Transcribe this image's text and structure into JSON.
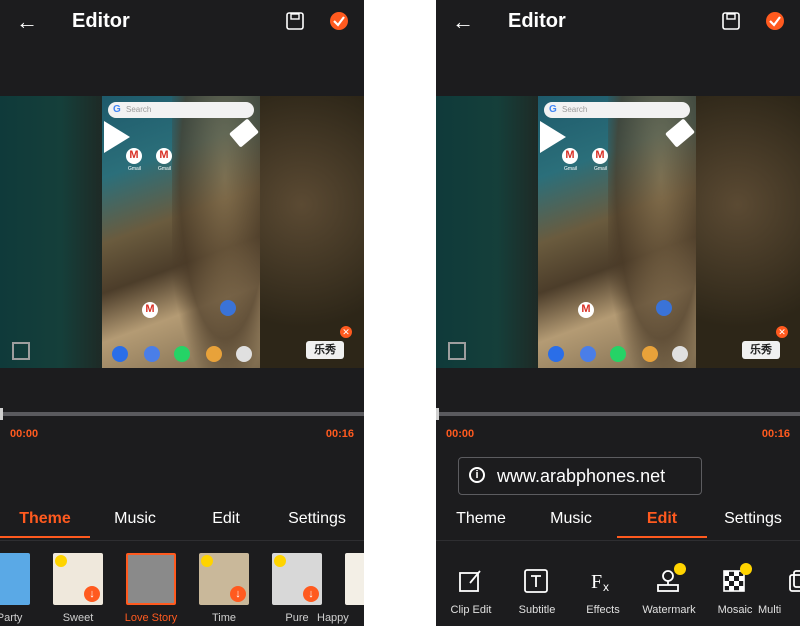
{
  "app": {
    "title": "Editor"
  },
  "colors": {
    "accent": "#ff5a1f",
    "background": "#1c1c1e"
  },
  "preview": {
    "search_placeholder": "Search",
    "apps": [
      "Gmail",
      "Gmail"
    ],
    "watermark_text": "乐秀"
  },
  "timeline": {
    "start": "00:00",
    "end": "00:16"
  },
  "tabs": [
    "Theme",
    "Music",
    "Edit",
    "Settings"
  ],
  "left_panel": {
    "active_tab": "Theme",
    "themes": [
      {
        "label": "e Party"
      },
      {
        "label": "Sweet"
      },
      {
        "label": "Love Story"
      },
      {
        "label": "Time"
      },
      {
        "label": "Pure"
      },
      {
        "label": "Happy"
      }
    ]
  },
  "right_panel": {
    "active_tab": "Edit",
    "overlay_url": "www.arabphones.net",
    "tools": [
      {
        "label": "Clip Edit",
        "icon": "clip-edit-icon"
      },
      {
        "label": "Subtitle",
        "icon": "subtitle-icon"
      },
      {
        "label": "Effects",
        "icon": "effects-icon"
      },
      {
        "label": "Watermark",
        "icon": "watermark-icon"
      },
      {
        "label": "Mosaic",
        "icon": "mosaic-icon"
      },
      {
        "label": "Multi",
        "icon": "multi-icon"
      }
    ]
  }
}
